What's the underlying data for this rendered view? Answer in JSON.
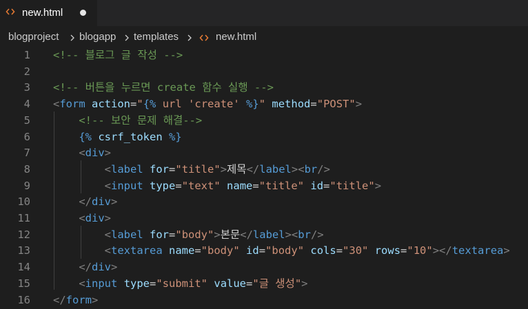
{
  "tab": {
    "label": "new.html",
    "icon": "html-file-icon",
    "unsaved": true
  },
  "breadcrumb": {
    "items": [
      "blogproject",
      "blogapp",
      "templates",
      "new.html"
    ]
  },
  "editor": {
    "lines": [
      {
        "n": "1",
        "tokens": [
          [
            "com",
            "<!-- 블로그 글 작성 -->"
          ]
        ]
      },
      {
        "n": "2",
        "tokens": []
      },
      {
        "n": "3",
        "tokens": [
          [
            "com",
            "<!-- 버튼을 누르면 create 함수 실행 -->"
          ]
        ]
      },
      {
        "n": "4",
        "tokens": [
          [
            "punc",
            "<"
          ],
          [
            "tag",
            "form"
          ],
          [
            "text",
            " "
          ],
          [
            "attr",
            "action"
          ],
          [
            "text",
            "="
          ],
          [
            "str",
            "\""
          ],
          [
            "tpl",
            "{%"
          ],
          [
            "str",
            " url 'create' "
          ],
          [
            "tpl",
            "%}"
          ],
          [
            "str",
            "\""
          ],
          [
            "text",
            " "
          ],
          [
            "attr",
            "method"
          ],
          [
            "text",
            "="
          ],
          [
            "str",
            "\"POST\""
          ],
          [
            "punc",
            ">"
          ]
        ]
      },
      {
        "n": "5",
        "tokens": [
          [
            "text",
            "    "
          ],
          [
            "com",
            "<!-- 보안 문제 해결-->"
          ]
        ]
      },
      {
        "n": "6",
        "tokens": [
          [
            "text",
            "    "
          ],
          [
            "tpl",
            "{%"
          ],
          [
            "text",
            " "
          ],
          [
            "tplname",
            "csrf_token"
          ],
          [
            "text",
            " "
          ],
          [
            "tpl",
            "%}"
          ]
        ]
      },
      {
        "n": "7",
        "tokens": [
          [
            "text",
            "    "
          ],
          [
            "punc",
            "<"
          ],
          [
            "tag",
            "div"
          ],
          [
            "punc",
            ">"
          ]
        ]
      },
      {
        "n": "8",
        "tokens": [
          [
            "text",
            "        "
          ],
          [
            "punc",
            "<"
          ],
          [
            "tag",
            "label"
          ],
          [
            "text",
            " "
          ],
          [
            "attr",
            "for"
          ],
          [
            "text",
            "="
          ],
          [
            "str",
            "\"title\""
          ],
          [
            "punc",
            ">"
          ],
          [
            "text",
            "제목"
          ],
          [
            "punc",
            "</"
          ],
          [
            "tag",
            "label"
          ],
          [
            "punc",
            ">"
          ],
          [
            "punc",
            "<"
          ],
          [
            "tag",
            "br"
          ],
          [
            "punc",
            "/>"
          ]
        ]
      },
      {
        "n": "9",
        "tokens": [
          [
            "text",
            "        "
          ],
          [
            "punc",
            "<"
          ],
          [
            "tag",
            "input"
          ],
          [
            "text",
            " "
          ],
          [
            "attr",
            "type"
          ],
          [
            "text",
            "="
          ],
          [
            "str",
            "\"text\""
          ],
          [
            "text",
            " "
          ],
          [
            "attr",
            "name"
          ],
          [
            "text",
            "="
          ],
          [
            "str",
            "\"title\""
          ],
          [
            "text",
            " "
          ],
          [
            "attr",
            "id"
          ],
          [
            "text",
            "="
          ],
          [
            "str",
            "\"title\""
          ],
          [
            "punc",
            ">"
          ]
        ]
      },
      {
        "n": "10",
        "tokens": [
          [
            "text",
            "    "
          ],
          [
            "punc",
            "</"
          ],
          [
            "tag",
            "div"
          ],
          [
            "punc",
            ">"
          ]
        ]
      },
      {
        "n": "11",
        "tokens": [
          [
            "text",
            "    "
          ],
          [
            "punc",
            "<"
          ],
          [
            "tag",
            "div"
          ],
          [
            "punc",
            ">"
          ]
        ]
      },
      {
        "n": "12",
        "tokens": [
          [
            "text",
            "        "
          ],
          [
            "punc",
            "<"
          ],
          [
            "tag",
            "label"
          ],
          [
            "text",
            " "
          ],
          [
            "attr",
            "for"
          ],
          [
            "text",
            "="
          ],
          [
            "str",
            "\"body\""
          ],
          [
            "punc",
            ">"
          ],
          [
            "text",
            "본문"
          ],
          [
            "punc",
            "</"
          ],
          [
            "tag",
            "label"
          ],
          [
            "punc",
            ">"
          ],
          [
            "punc",
            "<"
          ],
          [
            "tag",
            "br"
          ],
          [
            "punc",
            "/>"
          ]
        ]
      },
      {
        "n": "13",
        "tokens": [
          [
            "text",
            "        "
          ],
          [
            "punc",
            "<"
          ],
          [
            "tag",
            "textarea"
          ],
          [
            "text",
            " "
          ],
          [
            "attr",
            "name"
          ],
          [
            "text",
            "="
          ],
          [
            "str",
            "\"body\""
          ],
          [
            "text",
            " "
          ],
          [
            "attr",
            "id"
          ],
          [
            "text",
            "="
          ],
          [
            "str",
            "\"body\""
          ],
          [
            "text",
            " "
          ],
          [
            "attr",
            "cols"
          ],
          [
            "text",
            "="
          ],
          [
            "str",
            "\"30\""
          ],
          [
            "text",
            " "
          ],
          [
            "attr",
            "rows"
          ],
          [
            "text",
            "="
          ],
          [
            "str",
            "\"10\""
          ],
          [
            "punc",
            "></"
          ],
          [
            "tag",
            "textarea"
          ],
          [
            "punc",
            ">"
          ]
        ]
      },
      {
        "n": "14",
        "tokens": [
          [
            "text",
            "    "
          ],
          [
            "punc",
            "</"
          ],
          [
            "tag",
            "div"
          ],
          [
            "punc",
            ">"
          ]
        ]
      },
      {
        "n": "15",
        "tokens": [
          [
            "text",
            "    "
          ],
          [
            "punc",
            "<"
          ],
          [
            "tag",
            "input"
          ],
          [
            "text",
            " "
          ],
          [
            "attr",
            "type"
          ],
          [
            "text",
            "="
          ],
          [
            "str",
            "\"submit\""
          ],
          [
            "text",
            " "
          ],
          [
            "attr",
            "value"
          ],
          [
            "text",
            "="
          ],
          [
            "str",
            "\"글 생성\""
          ],
          [
            "punc",
            ">"
          ]
        ]
      },
      {
        "n": "16",
        "tokens": [
          [
            "punc",
            "</"
          ],
          [
            "tag",
            "form"
          ],
          [
            "punc",
            ">"
          ]
        ]
      }
    ]
  }
}
